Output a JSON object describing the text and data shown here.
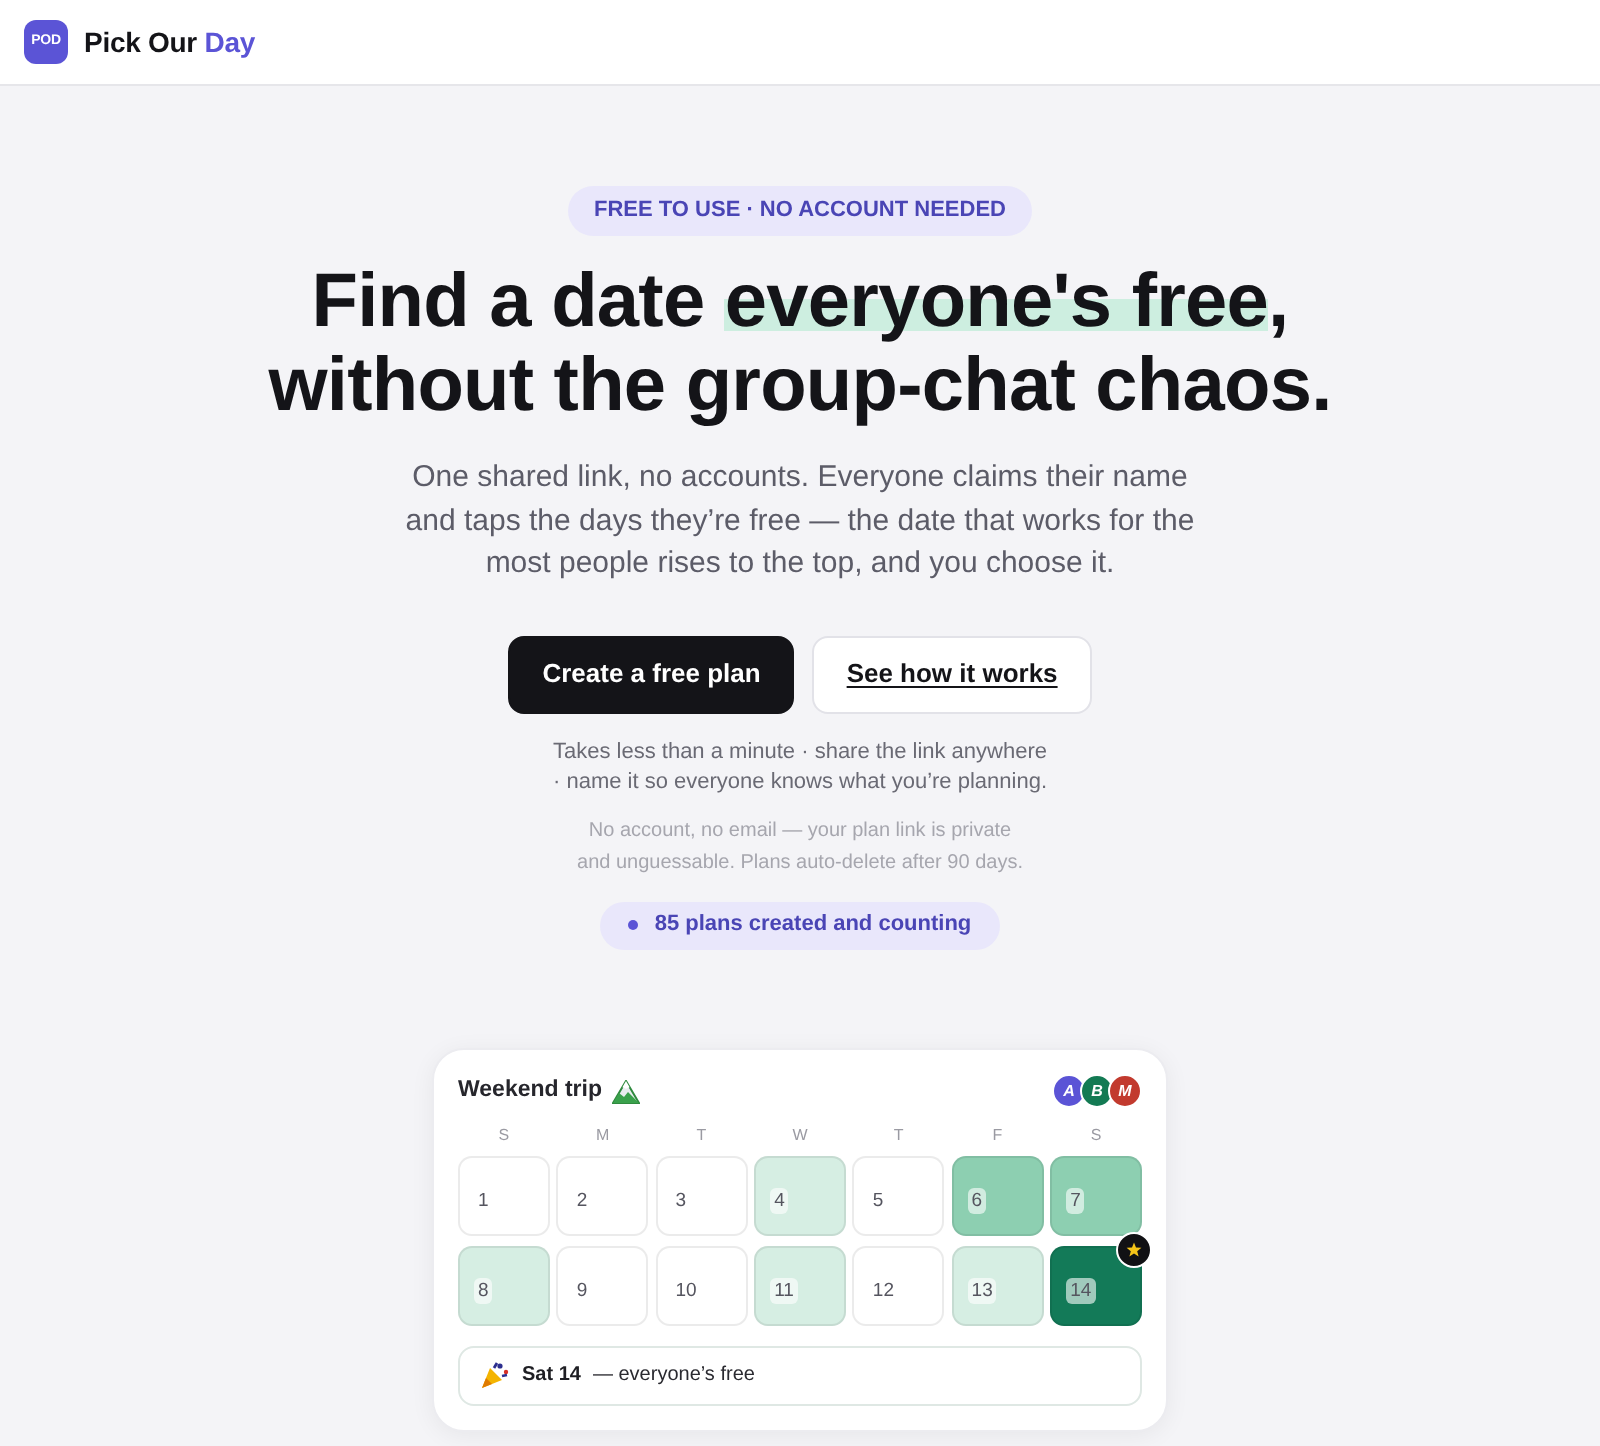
{
  "header": {
    "logo": "POD",
    "brand": "Pick Our",
    "brand_accent": "Day"
  },
  "hero": {
    "badge": "FREE TO USE · NO ACCOUNT NEEDED",
    "headline": {
      "line_1": {
        "before": "Find a date",
        "highlight": "everyone's free",
        "after": ","
      },
      "line_2": "without the group-chat chaos."
    },
    "subtitle": "One shared link, no accounts. Everyone claims their name and taps the days they’re free — the date that works for the most people rises to the top, and you choose it.",
    "buttons": [
      {
        "label": "Create a free plan",
        "kind": "primary"
      },
      {
        "label": "See how it works",
        "kind": "secondary"
      }
    ],
    "note": "Takes less than a minute · share the link anywhere · name it so everyone knows what you’re planning.",
    "privacy": "No account, no email — your plan link is private and unguessable. Plans auto-delete after 90 days.",
    "counter": "85 plans created and counting"
  },
  "preview": {
    "title": "Weekend trip",
    "avatars": [
      {
        "initial": "A",
        "color": "#5b54d6"
      },
      {
        "initial": "B",
        "color": "#137a53"
      },
      {
        "initial": "M",
        "color": "#c23a2e"
      }
    ],
    "weekdays": [
      "S",
      "M",
      "T",
      "W",
      "T",
      "F",
      "S"
    ],
    "days": [
      {
        "number": "1",
        "color": "#ffffff",
        "best": false
      },
      {
        "number": "2",
        "color": "#ffffff",
        "best": false
      },
      {
        "number": "3",
        "color": "#ffffff",
        "best": false
      },
      {
        "number": "4",
        "color": "#d6eee3",
        "best": false
      },
      {
        "number": "5",
        "color": "#ffffff",
        "best": false
      },
      {
        "number": "6",
        "color": "#8dcfb1",
        "best": false
      },
      {
        "number": "7",
        "color": "#8dcfb1",
        "best": false
      },
      {
        "number": "8",
        "color": "#d6eee3",
        "best": false
      },
      {
        "number": "9",
        "color": "#ffffff",
        "best": false
      },
      {
        "number": "10",
        "color": "#ffffff",
        "best": false
      },
      {
        "number": "11",
        "color": "#d6eee3",
        "best": false
      },
      {
        "number": "12",
        "color": "#ffffff",
        "best": false
      },
      {
        "number": "13",
        "color": "#d6eee3",
        "best": false
      },
      {
        "number": "14",
        "color": "#137a58",
        "best": true
      }
    ],
    "result": {
      "date": "Sat 14",
      "text": "— everyone’s free"
    }
  }
}
